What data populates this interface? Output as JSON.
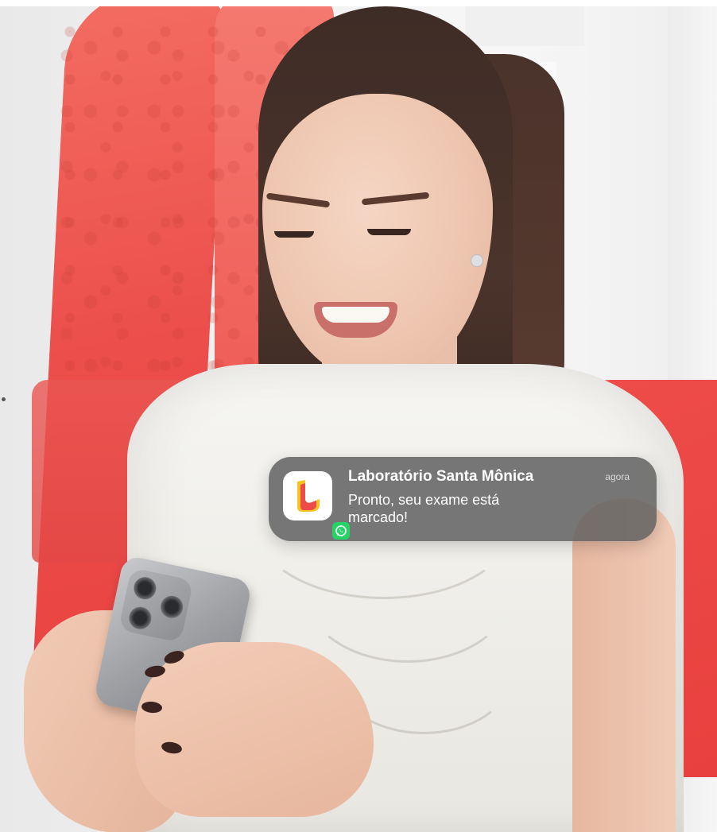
{
  "notification": {
    "app_name": "Laboratório Santa Mônica",
    "time": "agora",
    "message": "Pronto, seu exame está marcado!",
    "icon": "laboratorio-santa-monica-logo",
    "badge_icon": "whatsapp-icon"
  },
  "colors": {
    "brand_red": "#ed4b48",
    "brand_yellow": "#f7c41f",
    "notification_bg": "#626262",
    "whatsapp_green": "#25d366"
  },
  "scene": {
    "photo": "woman-smiling-looking-at-phone"
  }
}
